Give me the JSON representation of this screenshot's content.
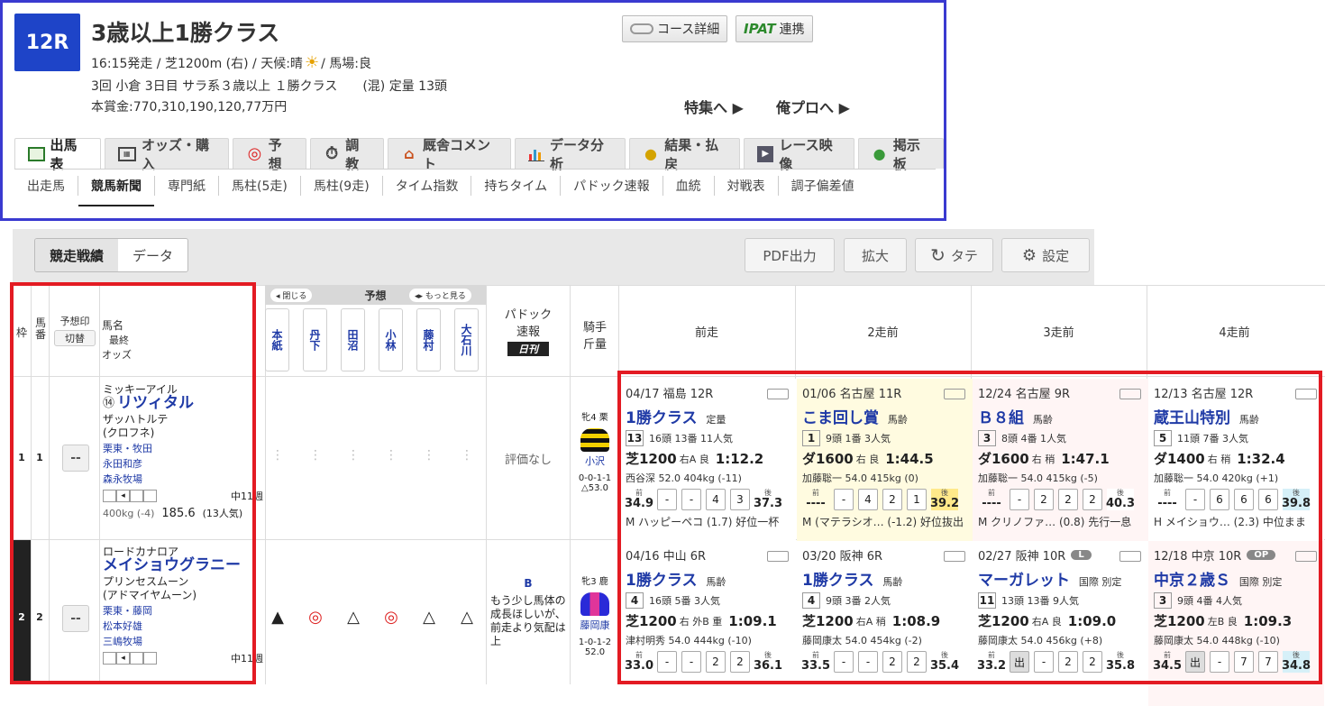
{
  "header": {
    "race_number": "12R",
    "title": "3歳以上1勝クラス",
    "conditions_pre": "16:15発走 / 芝1200m (右) / 天候:晴",
    "conditions_post": "/ 馬場:良",
    "info": "3回 小倉 3日目 サラ系３歳以上 １勝クラス　　(混) 定量 13頭",
    "prize": "本賞金:770,310,190,120,77万円",
    "course_detail_btn": "コース詳細",
    "ipat_logo": "IPAT",
    "ipat_btn": "連携",
    "feature_link": "特集へ ▶",
    "orepro_link": "俺プロへ ▶"
  },
  "tabs": [
    {
      "label": "出馬表",
      "icon": "card-icon",
      "active": true
    },
    {
      "label": "オッズ・購入",
      "icon": "ipat-card-icon"
    },
    {
      "label": "予想",
      "icon": "target-icon"
    },
    {
      "label": "調教",
      "icon": "stopwatch-icon"
    },
    {
      "label": "厩舎コメント",
      "icon": "stable-icon"
    },
    {
      "label": "データ分析",
      "icon": "bar-chart-icon"
    },
    {
      "label": "結果・払戻",
      "icon": "coins-icon"
    },
    {
      "label": "レース映像",
      "icon": "video-icon"
    },
    {
      "label": "掲示板",
      "icon": "chat-icon"
    }
  ],
  "subtabs": [
    "出走馬",
    "競馬新聞",
    "専門紙",
    "馬柱(5走)",
    "馬柱(9走)",
    "タイム指数",
    "持ちタイム",
    "パドック速報",
    "血統",
    "対戦表",
    "調子偏差値"
  ],
  "toolbar": {
    "seg_on": "競走戦績",
    "seg_off": "データ",
    "pdf": "PDF出力",
    "zoom": "拡大",
    "vertical": "タテ",
    "settings": "設定"
  },
  "table_header": {
    "waku": "枠",
    "umaban": "馬番",
    "mark_switch_1": "予想印",
    "mark_switch_2": "切替",
    "horse_col_1": "馬名",
    "horse_col_2": "最終",
    "horse_col_3": "オッズ",
    "yoso": "予想",
    "close_btn": "◂ 閉じる",
    "more_btn": "◂▸ もっと見る",
    "pundits": [
      "本紙",
      "丹下",
      "田沼",
      "小林",
      "藤村",
      "大石川"
    ],
    "paddock_1": "パドック",
    "paddock_2": "速報",
    "paddock_logo": "日刊",
    "jockey_1": "騎手",
    "jockey_2": "斤量",
    "past": [
      "前走",
      "2走前",
      "3走前",
      "4走前"
    ]
  },
  "horses": [
    {
      "waku": "1",
      "umaban": "1",
      "mark_btn": "--",
      "sire": "ミッキーアイル",
      "name": "リツィタル",
      "name_prefix": "⑭",
      "dam": "ザッハトルテ",
      "damsire": "(クロフネ)",
      "owner": "栗東・牧田",
      "trainer": "永田和彦",
      "breeder": "森永牧場",
      "interval": "中11週",
      "weight": "400kg (-4)",
      "odds": "185.6",
      "pop": "(13人気)",
      "marks": [
        "⋮",
        "⋮",
        "⋮",
        "⋮",
        "⋮",
        "⋮"
      ],
      "paddock": "評価なし",
      "jockey_info": "牝4 栗",
      "jockey": "小沢",
      "jockey_stats": "0-0-1-1",
      "kinryo": "△53.0",
      "past": [
        {
          "date": "04/17 福島 12R",
          "race": "1勝クラス",
          "cond": "定量",
          "badge": "13",
          "field": "16頭 13番 11人気",
          "main": "芝1200",
          "track": "右A 良",
          "time": "1:12.2",
          "jockey": "西谷深 52.0 404kg (-11)",
          "early": "34.9",
          "pos": [
            "-",
            "-",
            "4",
            "3"
          ],
          "late": "37.3",
          "winner": "M ハッピーペコ (1.7) 好位一杯",
          "bg": "#ffffff",
          "late_bg": "#ffffff"
        },
        {
          "date": "01/06 名古屋 11R",
          "race": "こま回し賞",
          "cond": "馬齢",
          "badge": "1",
          "field": "9頭 1番 3人気",
          "main": "ダ1600",
          "track": "右 良",
          "time": "1:44.5",
          "jockey": "加藤聡一 54.0 415kg (0)",
          "early": "----",
          "pos": [
            "-",
            "4",
            "2",
            "1"
          ],
          "late": "39.2",
          "winner": "M (マテラシオ… (-1.2) 好位抜出",
          "bg": "#fffbe0",
          "late_bg": "#ffe98a"
        },
        {
          "date": "12/24 名古屋 9R",
          "race": "Ｂ８組",
          "cond": "馬齢",
          "badge": "3",
          "field": "8頭 4番 1人気",
          "main": "ダ1600",
          "track": "右 稍",
          "time": "1:47.1",
          "jockey": "加藤聡一 54.0 415kg (-5)",
          "early": "----",
          "pos": [
            "-",
            "2",
            "2",
            "2"
          ],
          "late": "40.3",
          "winner": "M クリノファ… (0.8) 先行一息",
          "bg": "#fff5f5",
          "late_bg": "#ffffff"
        },
        {
          "date": "12/13 名古屋 12R",
          "race": "蔵王山特別",
          "cond": "馬齢",
          "badge": "5",
          "field": "11頭 7番 3人気",
          "main": "ダ1400",
          "track": "右 稍",
          "time": "1:32.4",
          "jockey": "加藤聡一 54.0 420kg (+1)",
          "early": "----",
          "pos": [
            "-",
            "6",
            "6",
            "6"
          ],
          "late": "39.8",
          "winner": "H メイショウ… (2.3) 中位まま",
          "bg": "#ffffff",
          "late_bg": "#d6f0f8"
        }
      ]
    },
    {
      "waku": "2",
      "umaban": "2",
      "mark_btn": "--",
      "sire": "ロードカナロア",
      "name": "メイショウグラニー",
      "name_prefix": "",
      "dam": "プリンセスムーン",
      "damsire": "(アドマイヤムーン)",
      "owner": "栗東・藤岡",
      "trainer": "松本好雄",
      "breeder": "三嶋牧場",
      "interval": "中11週",
      "weight": "",
      "odds": "",
      "pop": "",
      "marks": [
        "▲",
        "◎",
        "△",
        "◎",
        "△",
        "△"
      ],
      "paddock_grade": "B",
      "paddock": "もう少し馬体の成長ほしいが、前走より気配は上",
      "jockey_info": "牝3 鹿",
      "jockey": "藤岡康",
      "jockey_stats": "1-0-1-2",
      "kinryo": "52.0",
      "past": [
        {
          "date": "04/16 中山 6R",
          "race": "1勝クラス",
          "cond": "馬齢",
          "badge": "4",
          "field": "16頭 5番 3人気",
          "main": "芝1200",
          "track": "右 外B 重",
          "time": "1:09.1",
          "jockey": "津村明秀 54.0 444kg (-10)",
          "early": "33.0",
          "pos": [
            "-",
            "-",
            "2",
            "2"
          ],
          "late": "36.1",
          "bg": "#ffffff",
          "late_bg": "#ffffff"
        },
        {
          "date": "03/20 阪神 6R",
          "race": "1勝クラス",
          "cond": "馬齢",
          "badge": "4",
          "field": "9頭 3番 2人気",
          "main": "芝1200",
          "track": "右A 稍",
          "time": "1:08.9",
          "jockey": "藤岡康太 54.0 454kg (-2)",
          "early": "33.5",
          "pos": [
            "-",
            "-",
            "2",
            "2"
          ],
          "late": "35.4",
          "bg": "#ffffff",
          "late_bg": "#ffffff"
        },
        {
          "date": "02/27 阪神 10R",
          "pill": "L",
          "race": "マーガレット",
          "cond": "国際 別定",
          "badge": "11",
          "field": "13頭 13番 9人気",
          "main": "芝1200",
          "track": "右A 良",
          "time": "1:09.0",
          "jockey": "藤岡康太 54.0 456kg (+8)",
          "early": "33.2",
          "pos": [
            "出",
            "-",
            "2",
            "2"
          ],
          "late": "35.8",
          "bg": "#ffffff",
          "late_bg": "#ffffff"
        },
        {
          "date": "12/18 中京 10R",
          "pill": "OP",
          "race": "中京２歳Ｓ",
          "cond": "国際 別定",
          "badge": "3",
          "field": "9頭 4番 4人気",
          "main": "芝1200",
          "track": "左B 良",
          "time": "1:09.3",
          "jockey": "藤岡康太 54.0 448kg (-10)",
          "early": "34.5",
          "pos": [
            "出",
            "-",
            "7",
            "7"
          ],
          "late": "34.8",
          "bg": "#fff5f5",
          "late_bg": "#d6f0f8"
        }
      ]
    }
  ]
}
